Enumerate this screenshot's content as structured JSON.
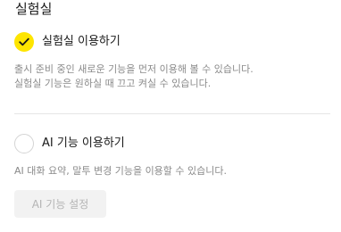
{
  "section": {
    "title": "실험실"
  },
  "lab": {
    "label": "실험실 이용하기",
    "checked": true,
    "description_line1": "출시 준비 중인 새로운 기능을 먼저 이용해 볼 수 있습니다.",
    "description_line2": "실험실 기능은 원하실 때 끄고 켜실 수 있습니다."
  },
  "ai": {
    "label": "AI 기능 이용하기",
    "checked": false,
    "description": "AI 대화 요약, 말투 변경 기능을 이용할 수 있습니다.",
    "settings_button": "AI 기능 설정",
    "settings_button_enabled": false
  },
  "colors": {
    "accent": "#fee500",
    "text": "#191919",
    "muted": "#8a8a8a",
    "disabled_bg": "#f2f2f2",
    "disabled_text": "#b4b4b4"
  },
  "icons": {
    "checked": "checkmark-icon"
  }
}
